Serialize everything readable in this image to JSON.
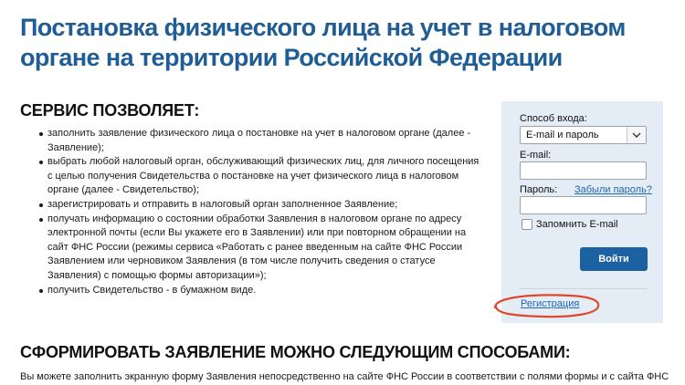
{
  "page": {
    "title": "Постановка физического лица на учет в налоговом органе на территории Российской Федерации"
  },
  "section1": {
    "heading": "Сервис позволяет:",
    "items": [
      "заполнить заявление физического лица о постановке на учет в налоговом органе (далее - Заявление);",
      "выбрать любой налоговый орган, обслуживающий физических лиц, для личного посещения с целью получения Свидетельства о постановке на учет физического лица в налоговом органе (далее - Свидетельство);",
      "зарегистрировать и отправить в налоговый орган заполненное Заявление;",
      "получать информацию о состоянии обработки Заявления в налоговом органе по адресу электронной почты (если Вы укажете его в Заявлении) или при повторном обращении на сайт ФНС России (режимы сервиса «Работать с ранее введенным на сайте ФНС России Заявлением или черновиком Заявления (в том числе получить сведения о статусе Заявления) с помощью формы авторизации»);",
      "получить Свидетельство - в бумажном виде."
    ]
  },
  "section2": {
    "heading": "Сформировать заявление можно следующим способами:",
    "text": "Вы можете заполнить экранную форму Заявления непосредственно на сайте ФНС России в соответствии с полями формы и с сайта ФНС"
  },
  "login": {
    "method_label": "Способ входа:",
    "method_value": "E-mail и пароль",
    "email_label": "E-mail:",
    "password_label": "Пароль:",
    "forgot_link": "Забыли пароль?",
    "remember_label": "Запомнить E-mail",
    "submit_label": "Войти",
    "register_link": "Регистрация",
    "remember_checked": false,
    "email_value": "",
    "password_value": ""
  },
  "colors": {
    "title": "#1f5d94",
    "panel_bg": "#e4ecf6",
    "button_bg": "#1c62a3",
    "link": "#2068b2",
    "highlight": "#e0482d"
  },
  "icons": {
    "select_arrow": "chevron-down-icon"
  }
}
